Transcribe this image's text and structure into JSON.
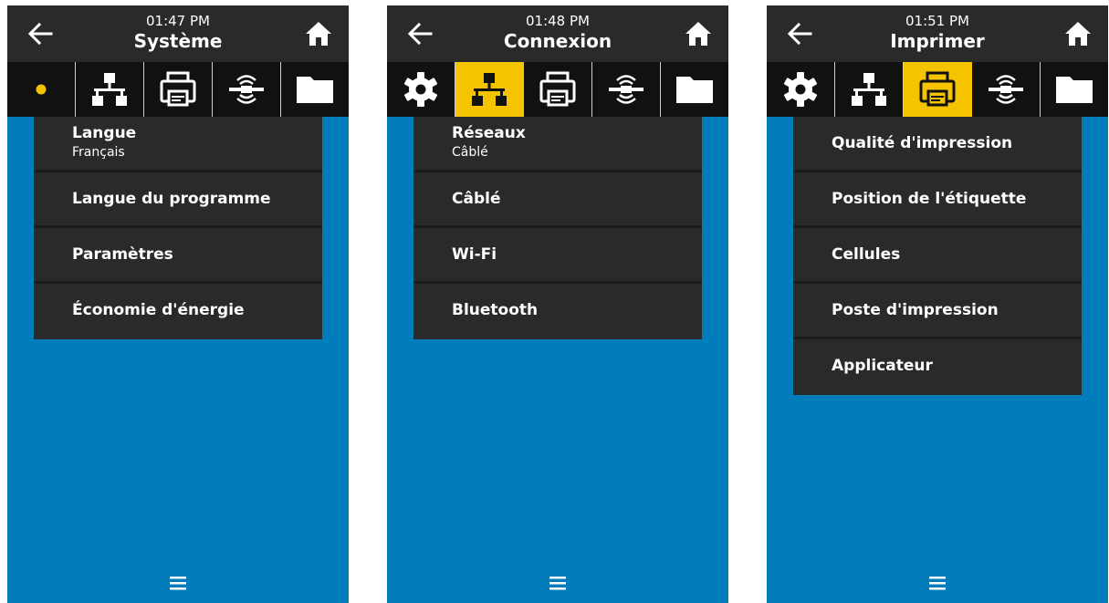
{
  "screens": [
    {
      "time": "01:47 PM",
      "title": "Système",
      "active_tab": 0,
      "menu": [
        {
          "label": "Langue",
          "sublabel": "Français"
        },
        {
          "label": "Langue du programme",
          "sublabel": ""
        },
        {
          "label": "Paramètres",
          "sublabel": ""
        },
        {
          "label": "Économie d'énergie",
          "sublabel": ""
        }
      ]
    },
    {
      "time": "01:48 PM",
      "title": "Connexion",
      "active_tab": 1,
      "menu": [
        {
          "label": "Réseaux",
          "sublabel": "Câblé"
        },
        {
          "label": "Câblé",
          "sublabel": ""
        },
        {
          "label": "Wi-Fi",
          "sublabel": ""
        },
        {
          "label": "Bluetooth",
          "sublabel": ""
        }
      ]
    },
    {
      "time": "01:51 PM",
      "title": "Imprimer",
      "active_tab": 2,
      "menu": [
        {
          "label": "Qualité d'impression",
          "sublabel": ""
        },
        {
          "label": "Position de l'étiquette",
          "sublabel": ""
        },
        {
          "label": "Cellules",
          "sublabel": ""
        },
        {
          "label": "Poste d'impression",
          "sublabel": ""
        },
        {
          "label": "Applicateur",
          "sublabel": ""
        }
      ]
    }
  ],
  "tabs": [
    {
      "icon": "gear-icon"
    },
    {
      "icon": "network-icon"
    },
    {
      "icon": "printer-icon"
    },
    {
      "icon": "rfid-icon"
    },
    {
      "icon": "folder-icon"
    }
  ],
  "colors": {
    "accent": "#f5c400",
    "background": "#007dba",
    "bar": "#2a2a2a"
  }
}
